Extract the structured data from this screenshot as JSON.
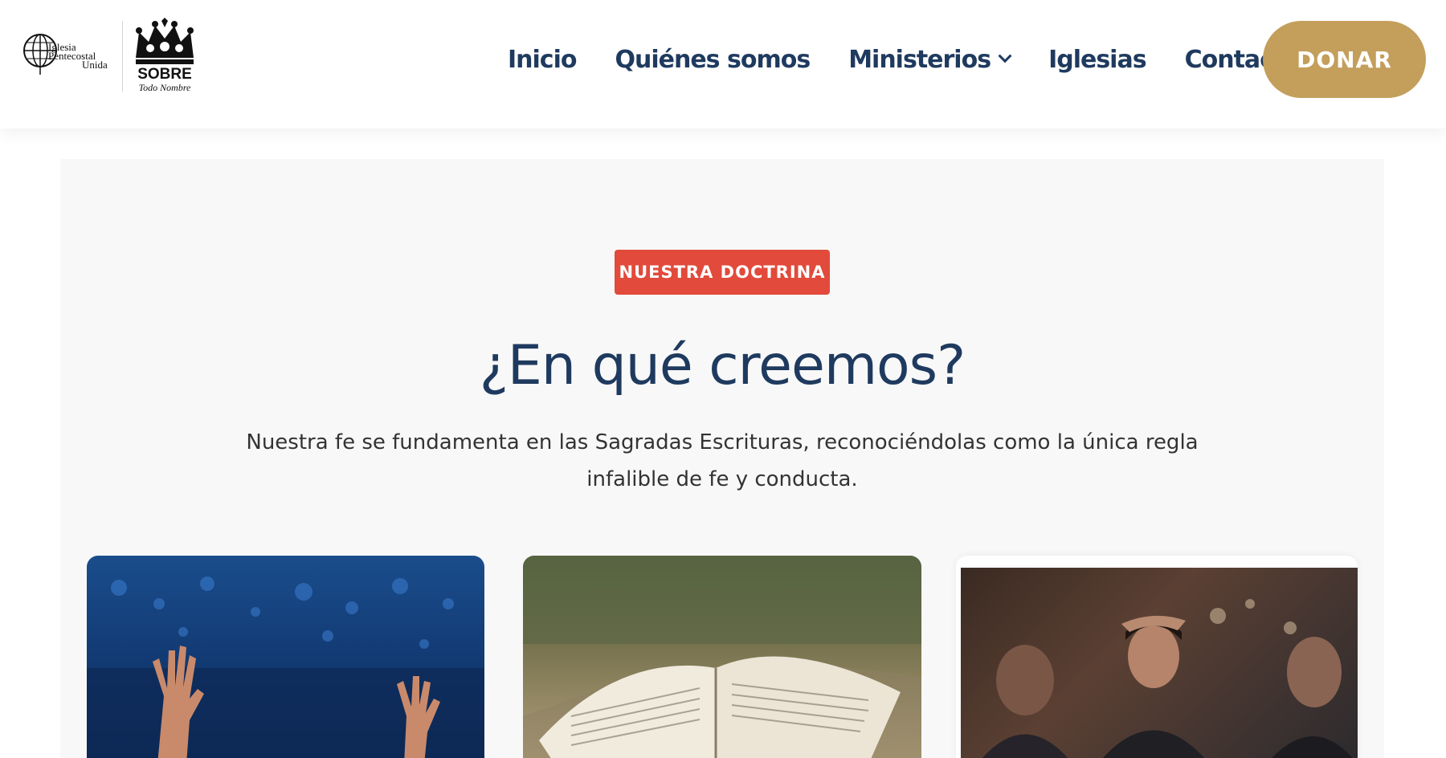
{
  "header": {
    "logo_left": {
      "icon": "globe-icon",
      "line1": "Iglesia",
      "line2": "Pentecostal",
      "line3": "Unida"
    },
    "logo_right": {
      "icon": "crown-icon",
      "word": "SOBRE",
      "tagline": "Todo Nombre"
    },
    "nav": [
      {
        "label": "Inicio"
      },
      {
        "label": "Quiénes somos"
      },
      {
        "label": "Ministerios",
        "icon": "chevron-down-icon"
      },
      {
        "label": "Iglesias"
      },
      {
        "label": "Contacto"
      }
    ],
    "donate_label": "DONAR"
  },
  "section": {
    "badge": "NUESTRA DOCTRINA",
    "title": "¿En qué creemos?",
    "subtitle": "Nuestra fe se fundamenta en las Sagradas Escrituras, reconociéndolas como la única regla infalible de fe y conducta."
  },
  "colors": {
    "navy": "#1f3a5f",
    "gold": "#c39f5b",
    "badge_red": "#e24a3b",
    "section_bg": "#f8f8f8"
  }
}
